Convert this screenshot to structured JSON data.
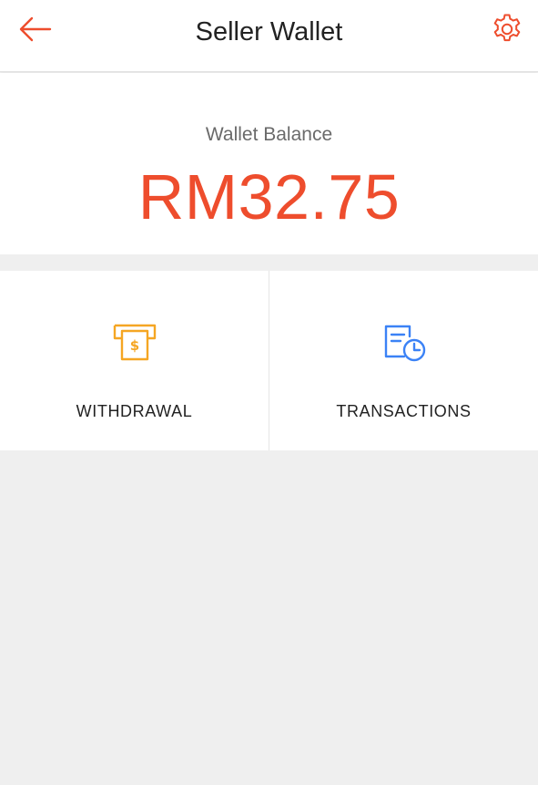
{
  "header": {
    "title": "Seller Wallet",
    "back_icon": "arrow-left-icon",
    "settings_icon": "gear-icon"
  },
  "wallet": {
    "label": "Wallet Balance",
    "amount": "RM32.75"
  },
  "actions": [
    {
      "label": "WITHDRAWAL",
      "icon": "atm-withdrawal-icon",
      "color": "#f5a623"
    },
    {
      "label": "TRANSACTIONS",
      "icon": "transaction-history-icon",
      "color": "#3b82f6"
    }
  ],
  "colors": {
    "accent": "#ee4d2d",
    "background": "#efefef"
  }
}
